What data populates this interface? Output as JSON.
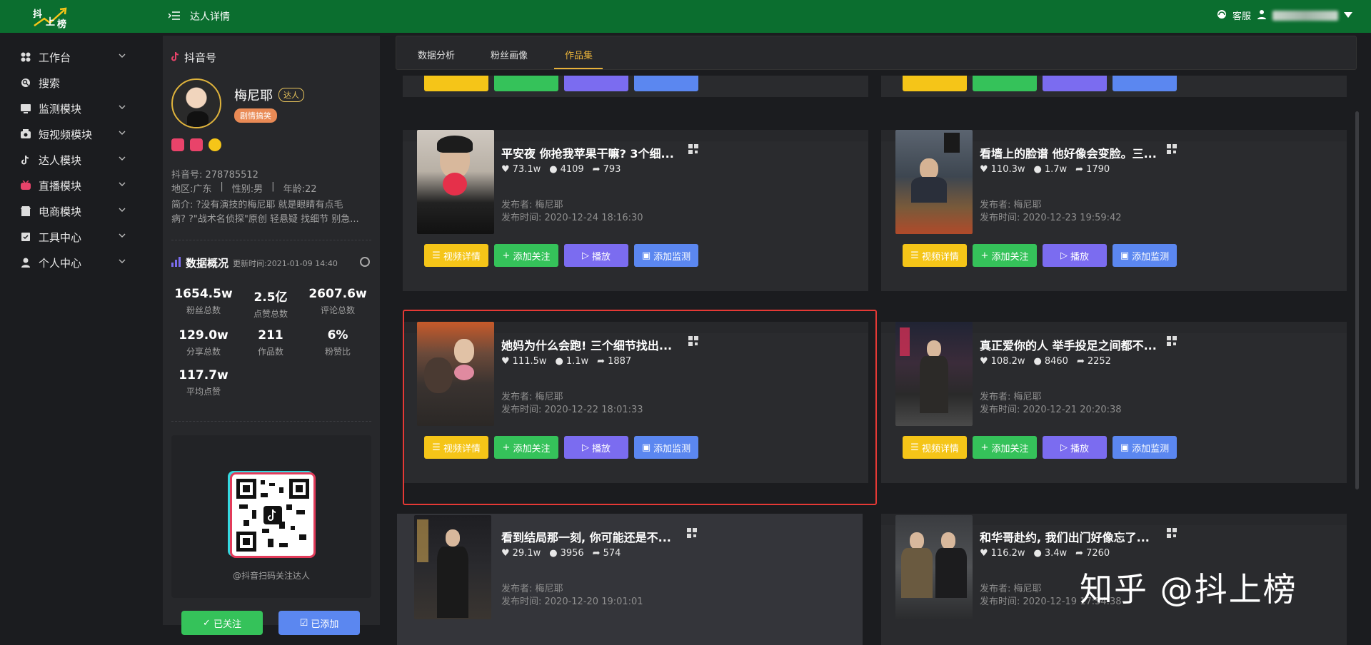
{
  "app": {
    "logo_text": [
      "抖",
      "上",
      "榜"
    ],
    "page_title": "达人详情",
    "service_label": "客服"
  },
  "colors": {
    "topbar": "#0b6e2f",
    "accent": "#e8b23a",
    "yellow": "#f5c518",
    "green": "#35c25a",
    "purple": "#7b6cf0",
    "blue": "#5b87f0",
    "highlight": "#e53935"
  },
  "sidebar": {
    "items": [
      {
        "label": "工作台",
        "icon": "dashboard-icon",
        "chevron": true
      },
      {
        "label": "搜索",
        "icon": "search-icon",
        "chevron": false
      },
      {
        "label": "监测模块",
        "icon": "monitor-icon",
        "chevron": true
      },
      {
        "label": "短视频模块",
        "icon": "video-icon",
        "chevron": true
      },
      {
        "label": "达人模块",
        "icon": "tiktok-icon",
        "chevron": true
      },
      {
        "label": "直播模块",
        "icon": "live-icon",
        "chevron": true
      },
      {
        "label": "电商模块",
        "icon": "shop-icon",
        "chevron": true
      },
      {
        "label": "工具中心",
        "icon": "tools-icon",
        "chevron": true
      },
      {
        "label": "个人中心",
        "icon": "user-icon",
        "chevron": true
      }
    ]
  },
  "profile": {
    "panel_title": "抖音号",
    "name": "梅尼耶",
    "tag": "达人",
    "category_tag": "剧情搞笑",
    "douyin_id": "抖音号: 278785512",
    "region": "地区:广东",
    "gender": "性别:男",
    "age": "年龄:22",
    "bio_line1": "简介: ?没有演技的梅尼耶 就是眼睛有点毛",
    "bio_line2": "病? ?\"战术名侦探\"原创 轻悬疑 找细节 别急...",
    "overview_title": "数据概况",
    "updated": "更新时间:2021-01-09 14:40",
    "stats": [
      {
        "value": "1654.5w",
        "label": "粉丝总数"
      },
      {
        "value": "2.5亿",
        "label": "点赞总数"
      },
      {
        "value": "2607.6w",
        "label": "评论总数"
      },
      {
        "value": "129.0w",
        "label": "分享总数"
      },
      {
        "value": "211",
        "label": "作品数"
      },
      {
        "value": "6%",
        "label": "粉赞比"
      },
      {
        "value": "117.7w",
        "label": "平均点赞"
      }
    ],
    "qr_caption": "@抖音扫码关注达人",
    "btn_followed": "已关注",
    "btn_added": "已添加"
  },
  "tabs": [
    {
      "label": "数据分析"
    },
    {
      "label": "粉丝画像"
    },
    {
      "label": "作品集",
      "active": true
    }
  ],
  "card_buttons": {
    "detail": "视频详情",
    "follow": "添加关注",
    "play": "播放",
    "monitor": "添加监测"
  },
  "videos": [
    {
      "title": "平安夜 你抢我苹果干嘛? 3个细...",
      "likes": "73.1w",
      "comments": "4109",
      "shares": "793",
      "publisher": "发布者: 梅尼耶",
      "time": "发布时间: 2020-12-24 18:16:30"
    },
    {
      "title": "看墙上的脸谱 他好像会变脸。三...",
      "likes": "110.3w",
      "comments": "1.7w",
      "shares": "1790",
      "publisher": "发布者: 梅尼耶",
      "time": "发布时间: 2020-12-23 19:59:42"
    },
    {
      "title": "她妈为什么会跑! 三个细节找出...",
      "likes": "111.5w",
      "comments": "1.1w",
      "shares": "1887",
      "publisher": "发布者: 梅尼耶",
      "time": "发布时间: 2020-12-22 18:01:33"
    },
    {
      "title": "真正爱你的人 举手投足之间都不...",
      "likes": "108.2w",
      "comments": "8460",
      "shares": "2252",
      "publisher": "发布者: 梅尼耶",
      "time": "发布时间: 2020-12-21 20:20:38"
    },
    {
      "title": "看到结局那一刻, 你可能还是不...",
      "likes": "29.1w",
      "comments": "3956",
      "shares": "574",
      "publisher": "发布者: 梅尼耶",
      "time": "发布时间: 2020-12-20 19:01:01"
    },
    {
      "title": "和华哥赴约, 我们出门好像忘了...",
      "likes": "116.2w",
      "comments": "3.4w",
      "shares": "7260",
      "publisher": "发布者: 梅尼耶",
      "time": "发布时间: 2020-12-19 17:54:38"
    }
  ],
  "watermark": "知乎 @抖上榜"
}
